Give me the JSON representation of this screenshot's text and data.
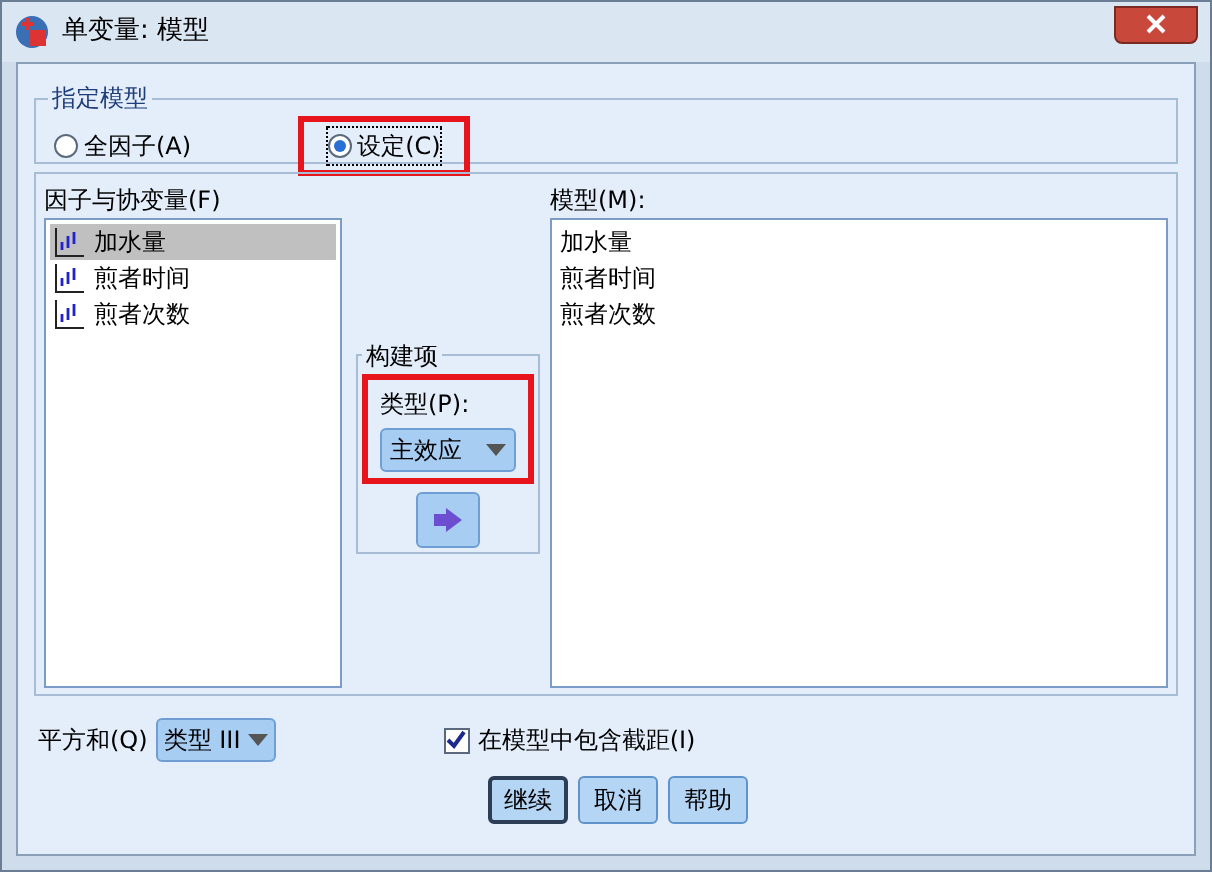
{
  "window": {
    "title": "单变量: 模型"
  },
  "model_spec": {
    "legend": "指定模型",
    "options": [
      {
        "label": "全因子(A)",
        "selected": false,
        "highlighted": false
      },
      {
        "label": "设定(C)",
        "selected": true,
        "highlighted": true
      }
    ]
  },
  "factors": {
    "label": "因子与协变量(F)",
    "items": [
      {
        "label": "加水量",
        "selected": true
      },
      {
        "label": "煎者时间",
        "selected": false
      },
      {
        "label": "煎者次数",
        "selected": false
      }
    ]
  },
  "build_term": {
    "legend": "构建项",
    "type_label": "类型(P):",
    "type_value": "主效应",
    "highlighted": true
  },
  "model": {
    "label": "模型(M):",
    "items": [
      {
        "label": "加水量"
      },
      {
        "label": "煎者时间"
      },
      {
        "label": "煎者次数"
      }
    ]
  },
  "sum_of_squares": {
    "label": "平方和(Q)",
    "value": "类型 III"
  },
  "include_intercept": {
    "label": "在模型中包含截距(I)",
    "checked": true
  },
  "buttons": [
    {
      "label": "继续",
      "default": true
    },
    {
      "label": "取消",
      "default": false
    },
    {
      "label": "帮助",
      "default": false
    }
  ]
}
